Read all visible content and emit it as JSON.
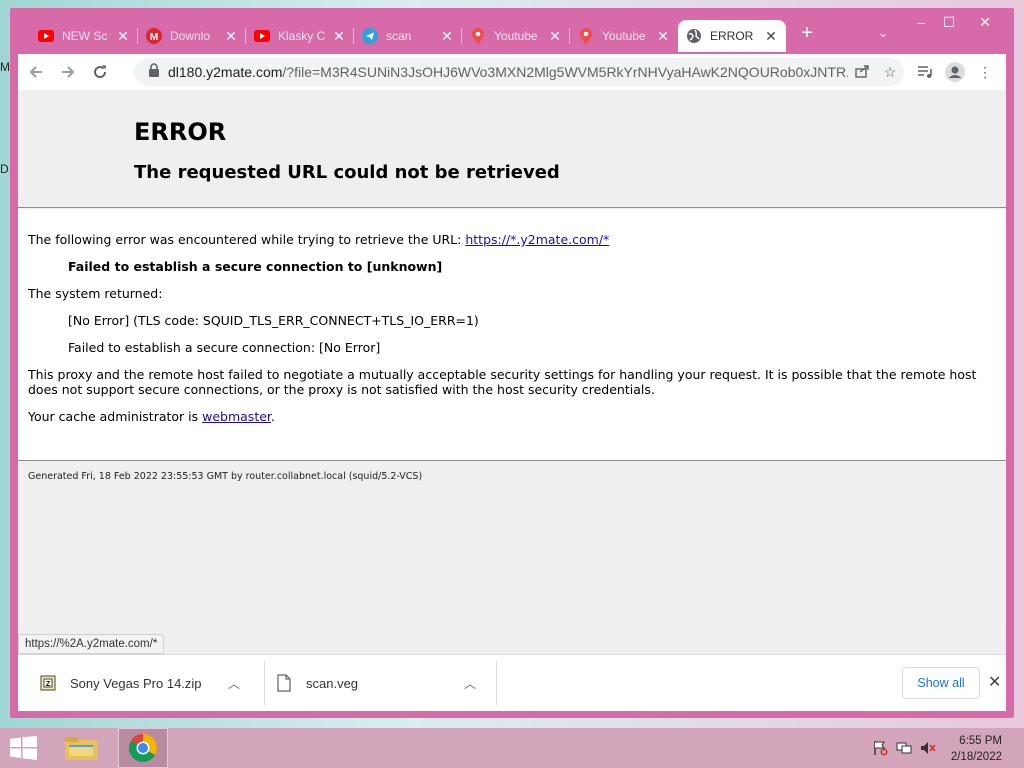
{
  "browser": {
    "tabs": [
      {
        "title": "NEW Sc",
        "icon": "youtube-icon"
      },
      {
        "title": "Downlo",
        "icon": "mega-icon"
      },
      {
        "title": "Klasky C",
        "icon": "youtube-icon"
      },
      {
        "title": "scan",
        "icon": "telegram-icon"
      },
      {
        "title": "Youtube",
        "icon": "map-pin-icon"
      },
      {
        "title": "Youtube",
        "icon": "map-pin-icon"
      },
      {
        "title": "ERROR",
        "icon": "globe-icon",
        "active": true
      }
    ],
    "address": {
      "host": "dl180.y2mate.com",
      "path": "/?file=M3R4SUNiN3JsOHJ6WVo3MXN2Mlg5WVM5RkYrNHVyaHAwK2NQOURob0xJNTR..."
    },
    "status_url": "https://%2A.y2mate.com/*",
    "accent_color": "#d76aa8"
  },
  "page": {
    "title": "ERROR",
    "subtitle": "The requested URL could not be retrieved",
    "intro": "The following error was encountered while trying to retrieve the URL: ",
    "intro_link": "https://*.y2mate.com/*",
    "failed_msg": "Failed to establish a secure connection to [unknown]",
    "system_returned": "The system returned:",
    "no_error_code": "[No Error] (TLS code: SQUID_TLS_ERR_CONNECT+TLS_IO_ERR=1)",
    "failed_detail": "Failed to establish a secure connection: [No Error]",
    "explanation": "This proxy and the remote host failed to negotiate a mutually acceptable security settings for handling your request. It is possible that the remote host does not support secure connections, or the proxy is not satisfied with the host security credentials.",
    "admin_prefix": "Your cache administrator is ",
    "admin_link": "webmaster",
    "admin_suffix": ".",
    "footer": "Generated Fri, 18 Feb 2022 23:55:53 GMT by router.collabnet.local (squid/5.2-VCS)"
  },
  "downloads": {
    "items": [
      {
        "name": "Sony Vegas Pro 14.zip",
        "icon": "zip-file-icon"
      },
      {
        "name": "scan.veg",
        "icon": "file-icon"
      }
    ],
    "show_all_label": "Show all"
  },
  "taskbar": {
    "time": "6:55 PM",
    "date": "2/18/2022"
  },
  "desktop": {
    "edge_chars": [
      "M",
      "D"
    ]
  }
}
